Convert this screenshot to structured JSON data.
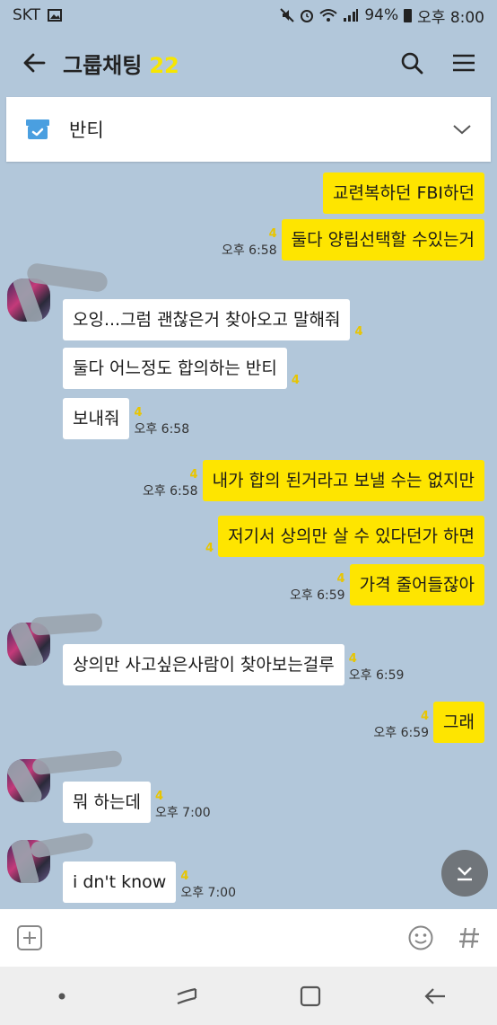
{
  "status_bar": {
    "carrier": "SKT",
    "battery": "94%",
    "time": "오후 8:00",
    "icons": [
      "image-icon",
      "mute-icon",
      "alarm-icon",
      "wifi-icon",
      "signal-icon",
      "battery-icon"
    ]
  },
  "header": {
    "title": "그룹채팅",
    "member_count": "22",
    "count_color": "#f7e600",
    "icons": [
      "back-arrow-icon",
      "search-icon",
      "menu-icon"
    ]
  },
  "notice": {
    "label": "반티",
    "icon": "notice-box-icon"
  },
  "messages": [
    {
      "sender": "me",
      "text": "교련복하던 FBI하던",
      "unread": "",
      "time": ""
    },
    {
      "sender": "me",
      "text": "둘다 양립선택할 수있는거",
      "unread": "4",
      "time": "오후 6:58"
    },
    {
      "sender": "other",
      "text": "오잉...그럼 괜찮은거 찾아오고 말해줘",
      "unread": "4",
      "time": ""
    },
    {
      "sender": "other",
      "text": "둘다 어느정도 합의하는 반티",
      "unread": "4",
      "time": ""
    },
    {
      "sender": "other",
      "text": "보내줘",
      "unread": "4",
      "time": "오후 6:58"
    },
    {
      "sender": "me",
      "text": "내가 합의 된거라고 보낼 수는 없지만",
      "unread": "4",
      "time": "오후 6:58"
    },
    {
      "sender": "me",
      "text": "저기서 상의만 살 수 있다던가 하면",
      "unread": "4",
      "time": ""
    },
    {
      "sender": "me",
      "text": "가격 줄어들잖아",
      "unread": "4",
      "time": "오후 6:59"
    },
    {
      "sender": "other",
      "text": "상의만 사고싶은사람이 찾아보는걸루",
      "unread": "4",
      "time": "오후 6:59"
    },
    {
      "sender": "me",
      "text": "그래",
      "unread": "4",
      "time": "오후 6:59"
    },
    {
      "sender": "other",
      "text": "뭐 하는데",
      "unread": "4",
      "time": "오후 7:00"
    },
    {
      "sender": "other",
      "text": "i dn't know",
      "unread": "4",
      "time": "오후 7:00"
    }
  ],
  "input": {
    "placeholder": "",
    "icons": [
      "plus-icon",
      "emoji-icon",
      "hash-icon"
    ]
  },
  "scroll_button": {
    "icon": "scroll-down-icon"
  },
  "nav": {
    "icons": [
      "dot-icon",
      "recent-apps-icon",
      "home-icon",
      "back-icon"
    ]
  },
  "colors": {
    "chat_bg": "#b2c7da",
    "my_bubble": "#fee500",
    "their_bubble": "#ffffff",
    "unread": "#e8c500"
  }
}
